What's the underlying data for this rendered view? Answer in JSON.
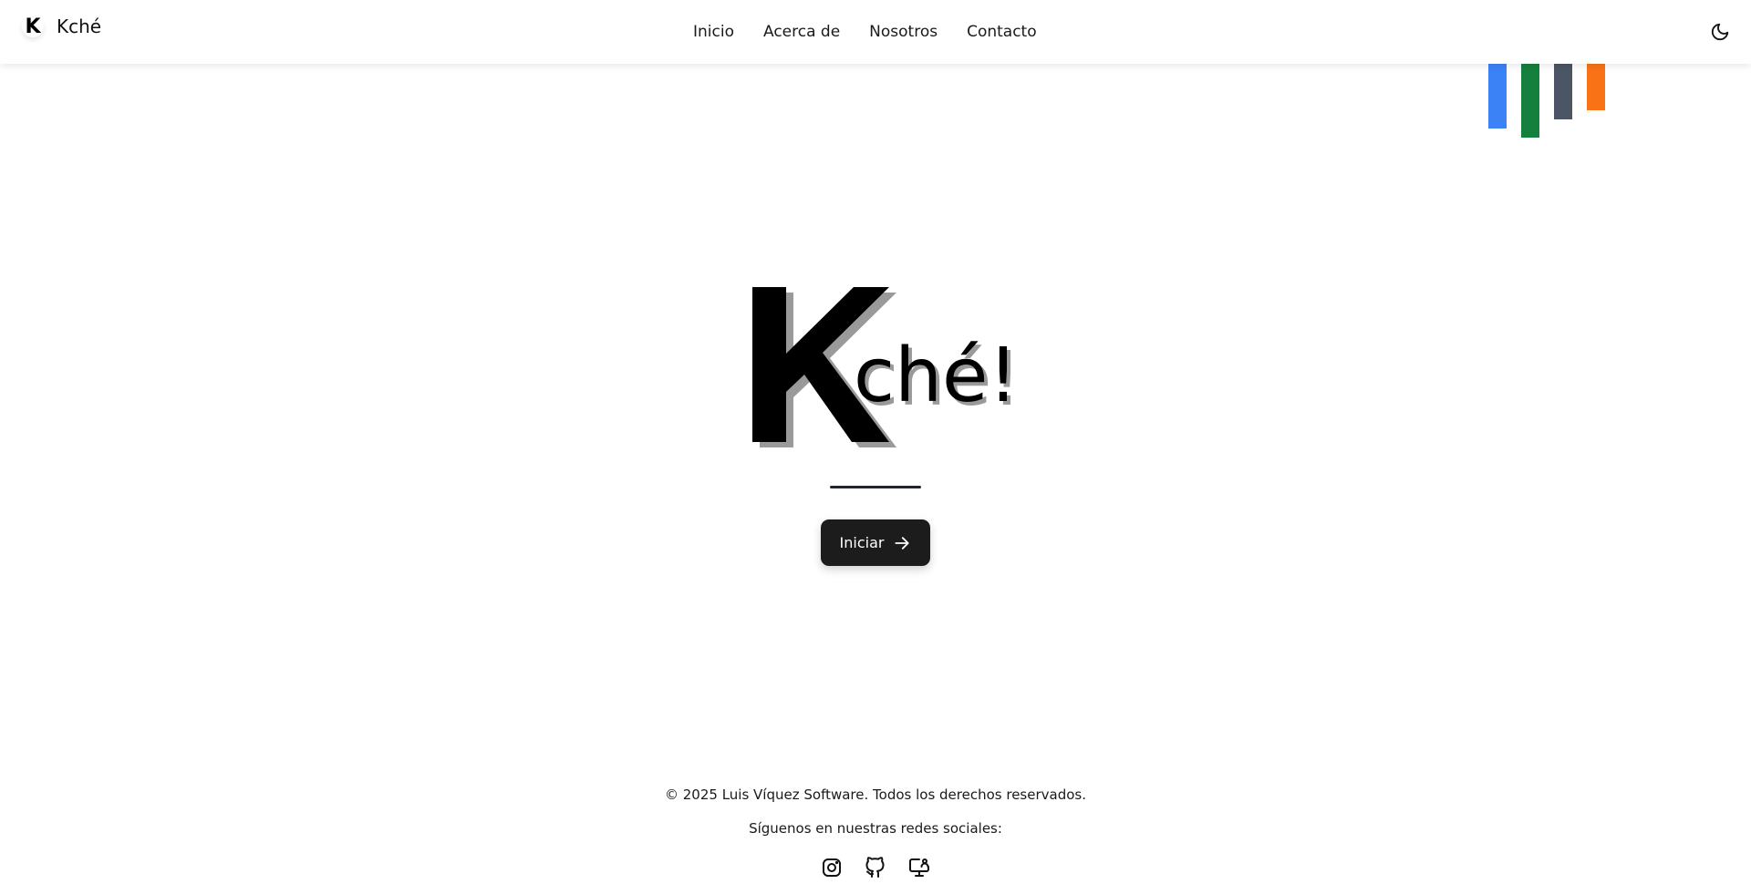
{
  "header": {
    "brand_letter": "K",
    "brand_name": "Kché",
    "nav": [
      "Inicio",
      "Acerca de",
      "Nosotros",
      "Contacto"
    ],
    "theme_icon": "moon-icon"
  },
  "decor": {
    "bar_colors": [
      "#3b82f6",
      "#15803d",
      "#4b5563",
      "#f97316"
    ]
  },
  "hero": {
    "logo_big": "K",
    "logo_rest": "ché!",
    "cta_label": "Iniciar",
    "cta_icon": "arrow-right-icon"
  },
  "footer": {
    "copyright": "© 2025 Luis Víquez Software. Todos los derechos reservados.",
    "follow": "Síguenos en nuestras redes sociales:",
    "socials": [
      "instagram-icon",
      "github-icon",
      "monitor-icon"
    ]
  }
}
